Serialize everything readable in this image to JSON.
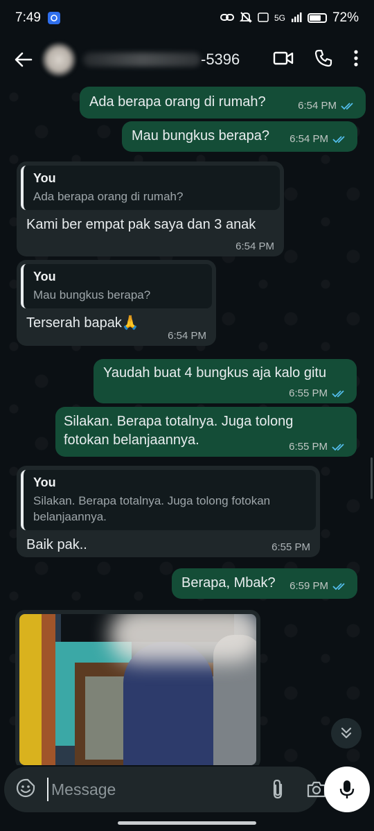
{
  "status_bar": {
    "time": "7:49",
    "network": "5G",
    "battery_percent": "72%",
    "battery_level": 0.72
  },
  "header": {
    "contact_visible_suffix": "-5396",
    "icons": [
      "back-arrow-icon",
      "video-call-icon",
      "voice-call-icon",
      "more-vertical-icon"
    ]
  },
  "messages": [
    {
      "dir": "out",
      "text": "Ada berapa orang di rumah?",
      "time": "6:54 PM"
    },
    {
      "dir": "out",
      "text": "Mau bungkus berapa?",
      "time": "6:54 PM"
    },
    {
      "dir": "in",
      "quote_author": "You",
      "quote_text": "Ada berapa orang di rumah?",
      "text": "Kami ber empat pak saya dan 3 anak",
      "time": "6:54 PM"
    },
    {
      "dir": "in",
      "quote_author": "You",
      "quote_text": "Mau bungkus berapa?",
      "text": "Terserah bapak🙏",
      "time": "6:54 PM"
    },
    {
      "dir": "out",
      "text": "Yaudah buat 4 bungkus aja kalo gitu",
      "time": "6:55 PM"
    },
    {
      "dir": "out",
      "text": "Silakan. Berapa totalnya. Juga tolong fotokan belanjaannya.",
      "time": "6:55 PM"
    },
    {
      "dir": "in",
      "quote_author": "You",
      "quote_text": "Silakan. Berapa totalnya. Juga tolong fotokan belanjaannya.",
      "text": "Baik pak..",
      "time": "6:55 PM"
    },
    {
      "dir": "out",
      "text": "Berapa, Mbak?",
      "time": "6:59 PM"
    }
  ],
  "composer": {
    "placeholder": "Message",
    "icons": [
      "emoji-icon",
      "attach-icon",
      "camera-icon",
      "mic-icon"
    ]
  }
}
